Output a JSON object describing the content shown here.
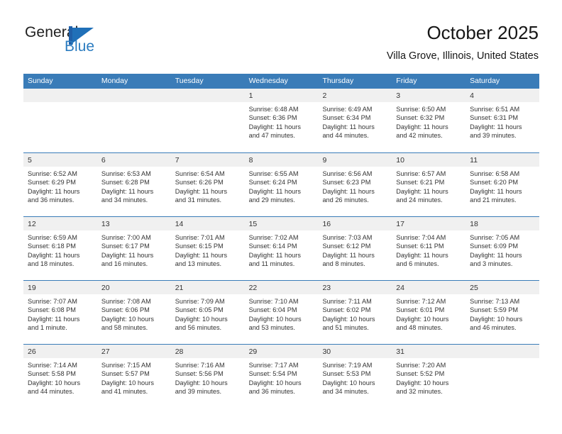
{
  "brand": {
    "name_primary": "General",
    "name_secondary": "Blue",
    "logo_icon": "triangle-flag-icon",
    "accent_color": "#2b7cc0"
  },
  "header": {
    "title": "October 2025",
    "location": "Villa Grove, Illinois, United States"
  },
  "colors": {
    "header_row_bg": "#3a7cb8",
    "day_band_bg": "#f0f0f0",
    "row_divider": "#3a7cb8",
    "text": "#333333"
  },
  "weekday_headers": [
    "Sunday",
    "Monday",
    "Tuesday",
    "Wednesday",
    "Thursday",
    "Friday",
    "Saturday"
  ],
  "weeks": [
    [
      {
        "day": "",
        "lines": []
      },
      {
        "day": "",
        "lines": []
      },
      {
        "day": "",
        "lines": []
      },
      {
        "day": "1",
        "lines": [
          "Sunrise: 6:48 AM",
          "Sunset: 6:36 PM",
          "Daylight: 11 hours",
          "and 47 minutes."
        ]
      },
      {
        "day": "2",
        "lines": [
          "Sunrise: 6:49 AM",
          "Sunset: 6:34 PM",
          "Daylight: 11 hours",
          "and 44 minutes."
        ]
      },
      {
        "day": "3",
        "lines": [
          "Sunrise: 6:50 AM",
          "Sunset: 6:32 PM",
          "Daylight: 11 hours",
          "and 42 minutes."
        ]
      },
      {
        "day": "4",
        "lines": [
          "Sunrise: 6:51 AM",
          "Sunset: 6:31 PM",
          "Daylight: 11 hours",
          "and 39 minutes."
        ]
      }
    ],
    [
      {
        "day": "5",
        "lines": [
          "Sunrise: 6:52 AM",
          "Sunset: 6:29 PM",
          "Daylight: 11 hours",
          "and 36 minutes."
        ]
      },
      {
        "day": "6",
        "lines": [
          "Sunrise: 6:53 AM",
          "Sunset: 6:28 PM",
          "Daylight: 11 hours",
          "and 34 minutes."
        ]
      },
      {
        "day": "7",
        "lines": [
          "Sunrise: 6:54 AM",
          "Sunset: 6:26 PM",
          "Daylight: 11 hours",
          "and 31 minutes."
        ]
      },
      {
        "day": "8",
        "lines": [
          "Sunrise: 6:55 AM",
          "Sunset: 6:24 PM",
          "Daylight: 11 hours",
          "and 29 minutes."
        ]
      },
      {
        "day": "9",
        "lines": [
          "Sunrise: 6:56 AM",
          "Sunset: 6:23 PM",
          "Daylight: 11 hours",
          "and 26 minutes."
        ]
      },
      {
        "day": "10",
        "lines": [
          "Sunrise: 6:57 AM",
          "Sunset: 6:21 PM",
          "Daylight: 11 hours",
          "and 24 minutes."
        ]
      },
      {
        "day": "11",
        "lines": [
          "Sunrise: 6:58 AM",
          "Sunset: 6:20 PM",
          "Daylight: 11 hours",
          "and 21 minutes."
        ]
      }
    ],
    [
      {
        "day": "12",
        "lines": [
          "Sunrise: 6:59 AM",
          "Sunset: 6:18 PM",
          "Daylight: 11 hours",
          "and 18 minutes."
        ]
      },
      {
        "day": "13",
        "lines": [
          "Sunrise: 7:00 AM",
          "Sunset: 6:17 PM",
          "Daylight: 11 hours",
          "and 16 minutes."
        ]
      },
      {
        "day": "14",
        "lines": [
          "Sunrise: 7:01 AM",
          "Sunset: 6:15 PM",
          "Daylight: 11 hours",
          "and 13 minutes."
        ]
      },
      {
        "day": "15",
        "lines": [
          "Sunrise: 7:02 AM",
          "Sunset: 6:14 PM",
          "Daylight: 11 hours",
          "and 11 minutes."
        ]
      },
      {
        "day": "16",
        "lines": [
          "Sunrise: 7:03 AM",
          "Sunset: 6:12 PM",
          "Daylight: 11 hours",
          "and 8 minutes."
        ]
      },
      {
        "day": "17",
        "lines": [
          "Sunrise: 7:04 AM",
          "Sunset: 6:11 PM",
          "Daylight: 11 hours",
          "and 6 minutes."
        ]
      },
      {
        "day": "18",
        "lines": [
          "Sunrise: 7:05 AM",
          "Sunset: 6:09 PM",
          "Daylight: 11 hours",
          "and 3 minutes."
        ]
      }
    ],
    [
      {
        "day": "19",
        "lines": [
          "Sunrise: 7:07 AM",
          "Sunset: 6:08 PM",
          "Daylight: 11 hours",
          "and 1 minute."
        ]
      },
      {
        "day": "20",
        "lines": [
          "Sunrise: 7:08 AM",
          "Sunset: 6:06 PM",
          "Daylight: 10 hours",
          "and 58 minutes."
        ]
      },
      {
        "day": "21",
        "lines": [
          "Sunrise: 7:09 AM",
          "Sunset: 6:05 PM",
          "Daylight: 10 hours",
          "and 56 minutes."
        ]
      },
      {
        "day": "22",
        "lines": [
          "Sunrise: 7:10 AM",
          "Sunset: 6:04 PM",
          "Daylight: 10 hours",
          "and 53 minutes."
        ]
      },
      {
        "day": "23",
        "lines": [
          "Sunrise: 7:11 AM",
          "Sunset: 6:02 PM",
          "Daylight: 10 hours",
          "and 51 minutes."
        ]
      },
      {
        "day": "24",
        "lines": [
          "Sunrise: 7:12 AM",
          "Sunset: 6:01 PM",
          "Daylight: 10 hours",
          "and 48 minutes."
        ]
      },
      {
        "day": "25",
        "lines": [
          "Sunrise: 7:13 AM",
          "Sunset: 5:59 PM",
          "Daylight: 10 hours",
          "and 46 minutes."
        ]
      }
    ],
    [
      {
        "day": "26",
        "lines": [
          "Sunrise: 7:14 AM",
          "Sunset: 5:58 PM",
          "Daylight: 10 hours",
          "and 44 minutes."
        ]
      },
      {
        "day": "27",
        "lines": [
          "Sunrise: 7:15 AM",
          "Sunset: 5:57 PM",
          "Daylight: 10 hours",
          "and 41 minutes."
        ]
      },
      {
        "day": "28",
        "lines": [
          "Sunrise: 7:16 AM",
          "Sunset: 5:56 PM",
          "Daylight: 10 hours",
          "and 39 minutes."
        ]
      },
      {
        "day": "29",
        "lines": [
          "Sunrise: 7:17 AM",
          "Sunset: 5:54 PM",
          "Daylight: 10 hours",
          "and 36 minutes."
        ]
      },
      {
        "day": "30",
        "lines": [
          "Sunrise: 7:19 AM",
          "Sunset: 5:53 PM",
          "Daylight: 10 hours",
          "and 34 minutes."
        ]
      },
      {
        "day": "31",
        "lines": [
          "Sunrise: 7:20 AM",
          "Sunset: 5:52 PM",
          "Daylight: 10 hours",
          "and 32 minutes."
        ]
      },
      {
        "day": "",
        "lines": []
      }
    ]
  ]
}
